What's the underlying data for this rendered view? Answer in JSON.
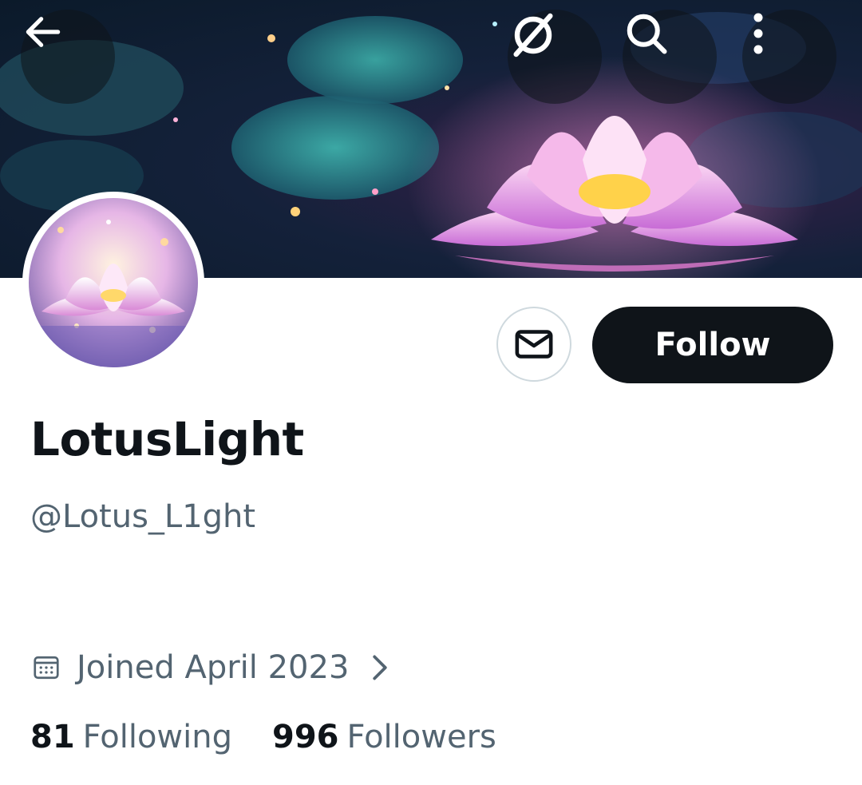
{
  "header": {
    "back_icon": "arrow-left-icon",
    "grok_icon": "grok-icon",
    "search_icon": "search-icon",
    "more_icon": "more-vertical-icon"
  },
  "profile": {
    "display_name": "LotusLight",
    "handle": "@Lotus_L1ght",
    "joined": "Joined April 2023",
    "follow_label": "Follow",
    "message_icon": "envelope-icon"
  },
  "stats": {
    "following_count": "81",
    "following_label": "Following",
    "followers_count": "996",
    "followers_label": "Followers"
  },
  "colors": {
    "text_primary": "#0f1419",
    "text_secondary": "#536471",
    "follow_bg": "#0f1419",
    "border": "#cfd9de"
  }
}
